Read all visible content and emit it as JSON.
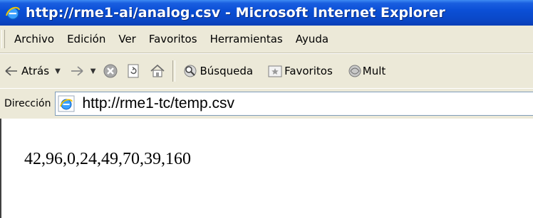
{
  "window": {
    "title": "http://rme1-ai/analog.csv - Microsoft Internet Explorer"
  },
  "menubar": {
    "items": [
      "Archivo",
      "Edición",
      "Ver",
      "Favoritos",
      "Herramientas",
      "Ayuda"
    ]
  },
  "toolbar": {
    "back_label": "Atrás",
    "search_label": "Búsqueda",
    "favorites_label": "Favoritos",
    "multimedia_label": "Mult",
    "icons": [
      "back-arrow-icon",
      "forward-arrow-icon",
      "stop-icon",
      "refresh-icon",
      "home-icon",
      "search-icon",
      "favorites-icon",
      "multimedia-icon"
    ]
  },
  "address": {
    "label": "Dirección",
    "url": "http://rme1-tc/temp.csv"
  },
  "content": {
    "text": "42,96,0,24,49,70,39,160"
  },
  "colors": {
    "titlebar": "#0a48c8",
    "chrome": "#ece9d8",
    "content_bg": "#ffffff"
  }
}
